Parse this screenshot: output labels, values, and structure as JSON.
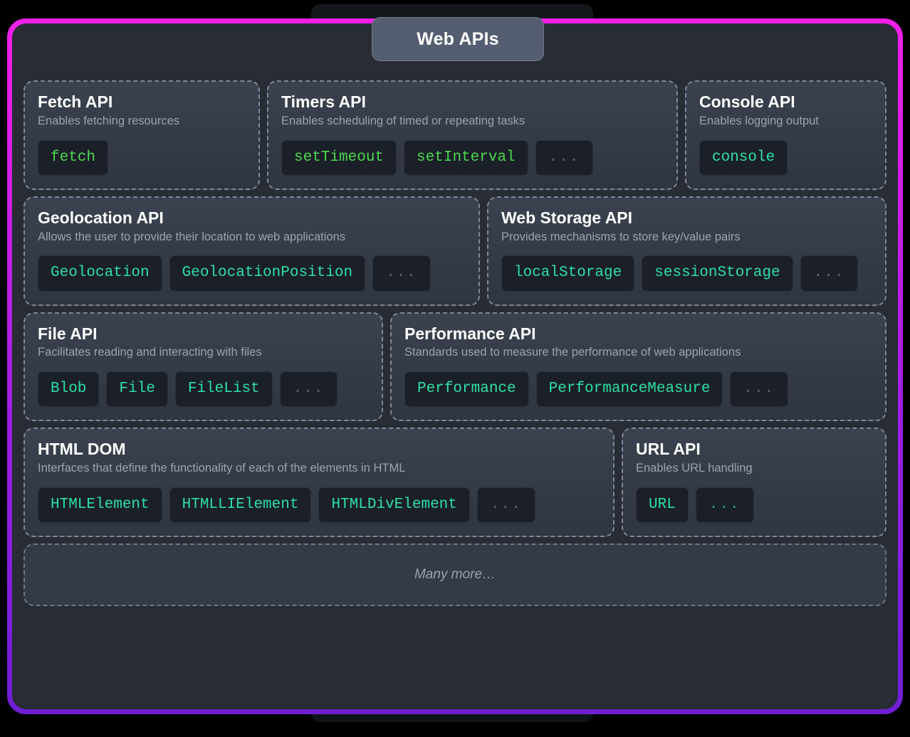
{
  "title": "Web APIs",
  "colors": {
    "border_top": "#ef1fe6",
    "border_bottom": "#6f1fd2",
    "panel_bg": "#272c35",
    "card_bg": "#343b47",
    "chip_bg": "#1b1f28",
    "function_green": "#4cd94f",
    "object_teal": "#2ee0a4",
    "muted_text": "#9aa3b2",
    "badge_bg": "#555d70"
  },
  "ellipsis": "...",
  "rows": [
    {
      "cards": [
        {
          "title": "Fetch API",
          "desc": "Enables fetching resources",
          "chips": [
            {
              "label": "fetch",
              "kind": "fn"
            }
          ]
        },
        {
          "title": "Timers API",
          "desc": "Enables scheduling of timed or repeating tasks",
          "chips": [
            {
              "label": "setTimeout",
              "kind": "fn"
            },
            {
              "label": "setInterval",
              "kind": "fn"
            },
            {
              "label": "...",
              "kind": "more"
            }
          ]
        },
        {
          "title": "Console API",
          "desc": "Enables logging output",
          "chips": [
            {
              "label": "console",
              "kind": "obj"
            }
          ]
        }
      ]
    },
    {
      "cards": [
        {
          "title": "Geolocation API",
          "desc": "Allows the user to provide their location to web applications",
          "chips": [
            {
              "label": "Geolocation",
              "kind": "obj"
            },
            {
              "label": "GeolocationPosition",
              "kind": "obj"
            },
            {
              "label": "...",
              "kind": "more"
            }
          ]
        },
        {
          "title": "Web Storage API",
          "desc": "Provides mechanisms to store key/value pairs",
          "chips": [
            {
              "label": "localStorage",
              "kind": "obj"
            },
            {
              "label": "sessionStorage",
              "kind": "obj"
            },
            {
              "label": "...",
              "kind": "more"
            }
          ]
        }
      ]
    },
    {
      "cards": [
        {
          "title": "File API",
          "desc": "Facilitates reading and interacting with files",
          "chips": [
            {
              "label": "Blob",
              "kind": "obj"
            },
            {
              "label": "File",
              "kind": "obj"
            },
            {
              "label": "FileList",
              "kind": "obj"
            },
            {
              "label": "...",
              "kind": "more"
            }
          ]
        },
        {
          "title": "Performance API",
          "desc": "Standards used to measure the performance of web applications",
          "chips": [
            {
              "label": "Performance",
              "kind": "obj"
            },
            {
              "label": "PerformanceMeasure",
              "kind": "obj"
            },
            {
              "label": "...",
              "kind": "more"
            }
          ]
        }
      ]
    },
    {
      "cards": [
        {
          "title": "HTML DOM",
          "desc": "Interfaces that define the functionality of each of the elements in HTML",
          "chips": [
            {
              "label": "HTMLElement",
              "kind": "obj"
            },
            {
              "label": "HTMLLIElement",
              "kind": "obj"
            },
            {
              "label": "HTMLDivElement",
              "kind": "obj"
            },
            {
              "label": "...",
              "kind": "more"
            }
          ]
        },
        {
          "title": "URL API",
          "desc": "Enables URL handling",
          "chips": [
            {
              "label": "URL",
              "kind": "obj"
            },
            {
              "label": "...",
              "kind": "more-t"
            }
          ]
        }
      ]
    }
  ],
  "footer": {
    "label": "Many more…"
  }
}
